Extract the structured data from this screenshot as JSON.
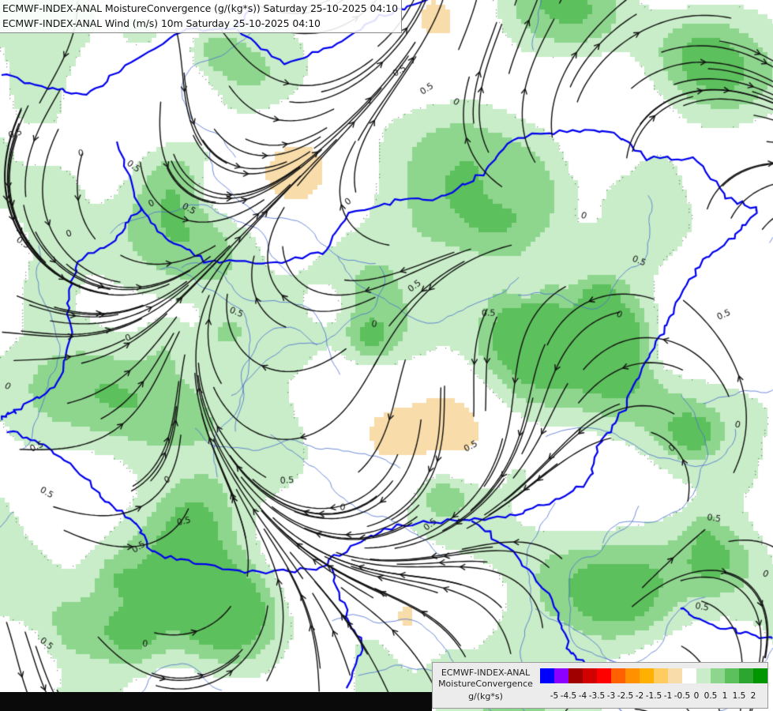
{
  "titles": {
    "line1": "ECMWF-INDEX-ANAL MoistureConvergence (g/(kg*s)) Saturday 25-10-2025 04:10",
    "line2": "ECMWF-INDEX-ANAL Wind (m/s) 10m Saturday 25-10-2025 04:10"
  },
  "legend": {
    "model": "ECMWF-INDEX-ANAL",
    "parameter": "MoistureConvergence",
    "unit": "g/(kg*s)",
    "colors": [
      "#0000ff",
      "#8b00ff",
      "#a00000",
      "#d20000",
      "#ff0000",
      "#ff6000",
      "#ff9000",
      "#ffb000",
      "#ffcc60",
      "#f8dcaa",
      "#ffffff",
      "#c8edc8",
      "#8ed68e",
      "#5cc05c",
      "#2ea52e",
      "#009600"
    ],
    "ticks": [
      "-5",
      "-4.5",
      "-4",
      "-3.5",
      "-3",
      "-2.5",
      "-2",
      "-1.5",
      "-1",
      "-0.5",
      "0",
      "0.5",
      "1",
      "1.5",
      "2"
    ]
  },
  "map": {
    "contour_labels": [
      "0.5",
      "0",
      "0.5",
      "0",
      "0.5",
      "0",
      "0.5",
      "0",
      "0.5",
      "0.5",
      "0",
      "0.5",
      "0",
      "0.5",
      "0",
      "0.5",
      "0",
      "0",
      "0.5",
      "0.5",
      "0",
      "0.5",
      "0",
      "0.5",
      "0.5",
      "0",
      "0.5",
      "0",
      "0.5",
      "0.5",
      "0",
      "0.5",
      "0.5",
      "0",
      "0.5",
      "0.5",
      "0"
    ],
    "colors": {
      "green_light": "#c8edc8",
      "green_mid": "#8ed68e",
      "green_dark": "#5cc05c",
      "orange_light": "#f8dcaa",
      "border": "#0000ee",
      "river": "#4a6fd0",
      "streamline": "#111111"
    }
  }
}
